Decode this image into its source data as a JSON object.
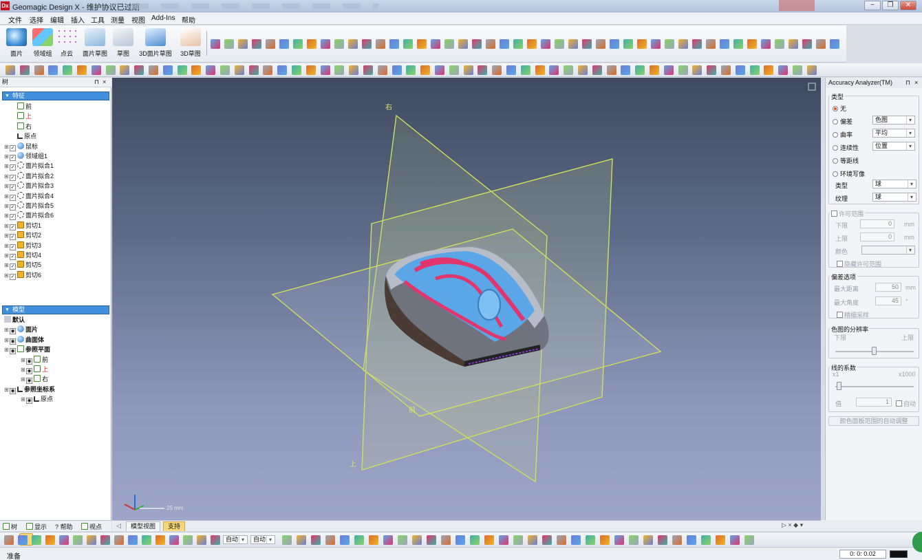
{
  "window": {
    "logo_text": "Dx",
    "title": "Geomagic Design X - 维护协议已过期",
    "minimize_glyph": "−",
    "maximize_glyph": "❐",
    "close_glyph": "✕"
  },
  "menu": [
    "文件",
    "选择",
    "编辑",
    "插入",
    "工具",
    "测量",
    "视图",
    "Add-Ins",
    "帮助"
  ],
  "ribbon": {
    "large_buttons": [
      {
        "label": "面片",
        "icon": "mesh-icon"
      },
      {
        "label": "领域组",
        "icon": "region-group-icon"
      },
      {
        "label": "点云",
        "icon": "point-cloud-icon"
      },
      {
        "label": "面片草图",
        "icon": "mesh-sketch-icon"
      },
      {
        "label": "草图",
        "icon": "sketch-icon"
      },
      {
        "label": "3D面片草图",
        "icon": "3d-mesh-sketch-icon"
      },
      {
        "label": "3D草图",
        "icon": "3d-sketch-icon"
      }
    ]
  },
  "feature_tree": {
    "panel_title": "树",
    "pin_glyph": "⊓",
    "close_glyph": "×",
    "header": "特征",
    "items": [
      {
        "label": "前",
        "icon": "plane-icon",
        "level": 1
      },
      {
        "label": "上",
        "icon": "plane-icon",
        "level": 1,
        "color": "#d01818"
      },
      {
        "label": "右",
        "icon": "plane-icon",
        "level": 1
      },
      {
        "label": "原点",
        "icon": "axis-icon",
        "level": 1
      },
      {
        "label": "鼠标",
        "icon": "sphere-icon",
        "level": 1
      },
      {
        "label": "领域组1",
        "icon": "region-icon",
        "level": 1
      },
      {
        "label": "面片拟合1",
        "icon": "fit-icon",
        "level": 1
      },
      {
        "label": "面片拟合2",
        "icon": "fit-icon",
        "level": 1
      },
      {
        "label": "面片拟合3",
        "icon": "fit-icon",
        "level": 1
      },
      {
        "label": "面片拟合4",
        "icon": "fit-icon",
        "level": 1
      },
      {
        "label": "面片拟合5",
        "icon": "fit-icon",
        "level": 1
      },
      {
        "label": "面片拟合6",
        "icon": "fit-icon",
        "level": 1
      },
      {
        "label": "剪切1",
        "icon": "cut-icon",
        "level": 1
      },
      {
        "label": "剪切2",
        "icon": "cut-icon",
        "level": 1
      },
      {
        "label": "剪切3",
        "icon": "cut-icon",
        "level": 1
      },
      {
        "label": "剪切4",
        "icon": "cut-icon",
        "level": 1
      },
      {
        "label": "剪切5",
        "icon": "cut-icon",
        "level": 1
      },
      {
        "label": "剪切6",
        "icon": "cut-icon",
        "level": 1
      }
    ]
  },
  "model_tree": {
    "header": "模型",
    "items": [
      {
        "label": "默认",
        "bold": true
      },
      {
        "label": "面片",
        "bold": true,
        "icon": "sphere-icon"
      },
      {
        "label": "曲面体",
        "bold": true,
        "icon": "surface-icon"
      },
      {
        "label": "参照平面",
        "bold": true,
        "icon": "plane-icon"
      },
      {
        "label": "前",
        "icon": "plane-icon",
        "sub": true
      },
      {
        "label": "上",
        "icon": "plane-icon",
        "sub": true,
        "color": "#d01818"
      },
      {
        "label": "右",
        "icon": "plane-icon",
        "sub": true
      },
      {
        "label": "参照坐标系",
        "bold": true,
        "icon": "axis-icon"
      },
      {
        "label": "原点",
        "icon": "axis-icon",
        "sub": true
      }
    ]
  },
  "left_tabs": [
    "树",
    "显示",
    "帮助",
    "视点"
  ],
  "viewport": {
    "plane_label_right": "右",
    "plane_label_top": "上",
    "plane_label_front": "前",
    "scale_text": "25 mm",
    "colors": {
      "plane": "#cfe05a",
      "mouse_blue": "#5aa6e6",
      "mouse_pink": "#e2356d",
      "mouse_shell": "#9ca3ae"
    }
  },
  "accuracy_analyzer": {
    "title": "Accuracy Analyzer(TM)",
    "pin_glyph": "⊓",
    "close_glyph": "×",
    "type_group": "类型",
    "options": [
      {
        "label": "无",
        "selected": true
      },
      {
        "label": "偏差",
        "select": "色图"
      },
      {
        "label": "曲率",
        "select": "平均"
      },
      {
        "label": "连续性",
        "select": "位置"
      },
      {
        "label": "等距线"
      },
      {
        "label": "环境写像"
      }
    ],
    "env_type_label": "类型",
    "env_type_value": "球",
    "env_texture_label": "纹理",
    "env_texture_value": "球",
    "tolerance_group": "许可范围",
    "lower_label": "下限",
    "lower_value": "0",
    "upper_label": "上限",
    "upper_value": "0",
    "unit_mm": "mm",
    "color_label": "颜色",
    "hide_tolerance": "隐藏许可范围",
    "deviation_group": "偏差选项",
    "max_distance_label": "最大距离",
    "max_distance_value": "50",
    "max_angle_label": "最大角度",
    "max_angle_value": "45",
    "angle_unit": "°",
    "fine_sampling": "精细采样",
    "resolution_group": "色图的分辨率",
    "res_low": "下限",
    "res_high": "上限",
    "line_factor_group": "线的系数",
    "factor_min": "x1",
    "factor_max": "x1000",
    "value_label": "值",
    "value": "1",
    "auto_label": "自动",
    "auto_adjust_button": "颜色面板范围的自动调整"
  },
  "bottom_tabs": [
    "模型视图",
    "支持"
  ],
  "bottom_right_glyphs": "▷ × ◆ ▾",
  "toolbar3": {
    "combo1": "自动",
    "combo2": "自动"
  },
  "status": {
    "text": "准备",
    "time": "0: 0: 0.02"
  }
}
